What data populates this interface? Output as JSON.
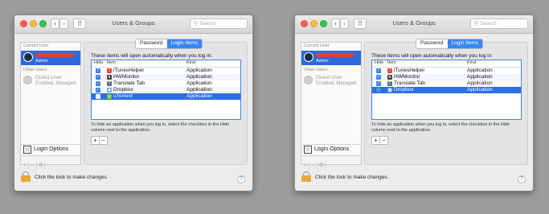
{
  "windows": [
    {
      "title": "Users & Groups",
      "search_placeholder": "Search",
      "sidebar": {
        "current_user_header": "Current User",
        "current_user_role": "Admin",
        "other_users_header": "Other Users",
        "guest_name": "Guest User",
        "guest_status": "Enabled, Managed",
        "login_options": "Login Options",
        "add": "+",
        "remove": "−",
        "gear": "⚙"
      },
      "tabs": {
        "password": "Password",
        "login_items": "Login Items"
      },
      "intro": "These items will open automatically when you log in:",
      "columns": {
        "hide": "Hide",
        "item": "Item",
        "kind": "Kind"
      },
      "rows": [
        {
          "name": "iTunesHelper",
          "kind": "Application",
          "checked": true
        },
        {
          "name": "HWMonitor",
          "kind": "Application",
          "checked": true
        },
        {
          "name": "Translate Tab",
          "kind": "Application",
          "checked": true
        },
        {
          "name": "Dropbox",
          "kind": "Application",
          "checked": true
        },
        {
          "name": "uTorrent",
          "kind": "Application",
          "checked": false
        }
      ],
      "hint": "To hide an application when you log in, select the checkbox in the Hide column next to the application.",
      "add_button": "+",
      "remove_button": "−",
      "lock_text": "Click the lock to make changes.",
      "help": "?"
    },
    {
      "title": "Users & Groups",
      "search_placeholder": "Search",
      "sidebar": {
        "current_user_header": "Current User",
        "current_user_role": "Admin",
        "other_users_header": "Other Users",
        "guest_name": "Guest User",
        "guest_status": "Enabled, Managed",
        "login_options": "Login Options",
        "add": "+",
        "remove": "−",
        "gear": "⚙"
      },
      "tabs": {
        "password": "Password",
        "login_items": "Login Items"
      },
      "intro": "These items will open automatically when you log in:",
      "columns": {
        "hide": "Hide",
        "item": "Item",
        "kind": "Kind"
      },
      "rows": [
        {
          "name": "iTunesHelper",
          "kind": "Application",
          "checked": true
        },
        {
          "name": "HWMonitor",
          "kind": "Application",
          "checked": true
        },
        {
          "name": "Translate Tab",
          "kind": "Application",
          "checked": true
        },
        {
          "name": "Dropbox",
          "kind": "Application",
          "checked": true
        }
      ],
      "hint": "To hide an application when you log in, select the checkbox in the Hide column next to the application.",
      "add_button": "+",
      "remove_button": "−",
      "lock_text": "Click the lock to make changes.",
      "help": "?"
    }
  ],
  "icons": [
    "search-icon",
    "back-icon",
    "forward-icon",
    "grid-icon",
    "avatar-icon",
    "guest-user-icon",
    "house-icon",
    "gear-icon",
    "lock-icon",
    "help-icon",
    "itunes-helper-icon",
    "hwmonitor-icon",
    "translate-tab-icon",
    "dropbox-icon",
    "utorrent-icon"
  ],
  "colors": {
    "selection": "#2a6ee8",
    "tab_active": "#3a86f4",
    "checkbox_on": "#3a82ec",
    "redaction": "#d9413c",
    "lock": "#e8a93b"
  }
}
